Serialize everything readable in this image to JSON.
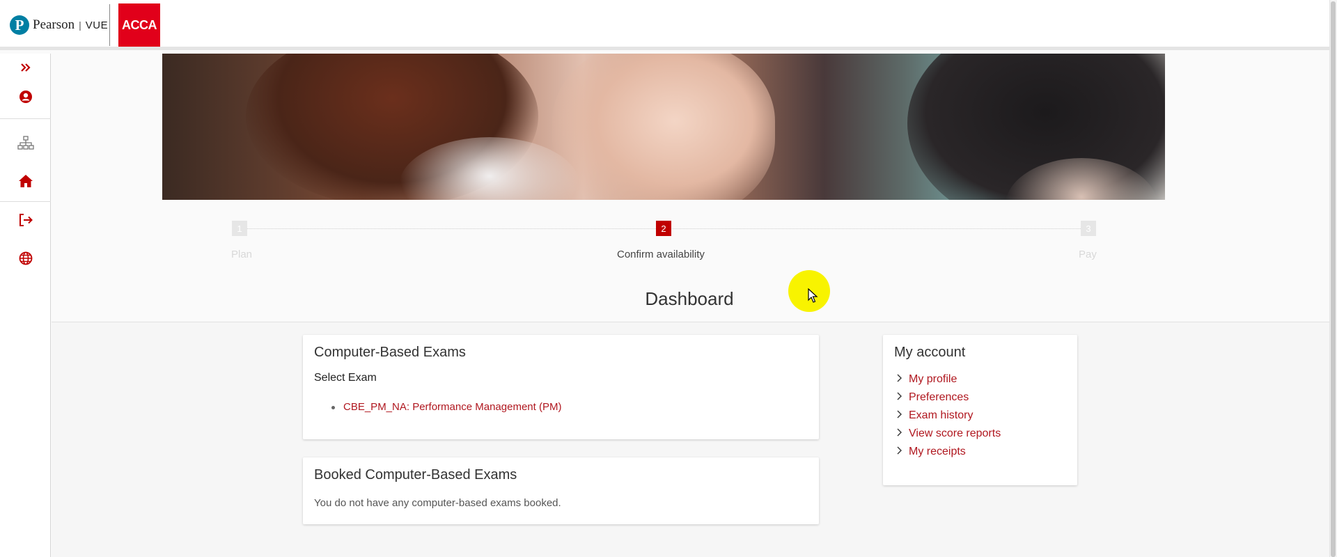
{
  "header": {
    "pearson_mark": "P",
    "pearson_word": "Pearson",
    "separator": "|",
    "vue": "VUE",
    "acca": "ACCA"
  },
  "sidebar": {
    "items": [
      {
        "icon": "expand-chevrons-icon"
      },
      {
        "icon": "user-icon"
      },
      {
        "icon": "sitemap-icon"
      },
      {
        "icon": "home-icon"
      },
      {
        "icon": "sign-out-icon"
      },
      {
        "icon": "globe-icon"
      }
    ]
  },
  "stepper": {
    "steps": [
      {
        "number": "1",
        "label": "Plan",
        "state": "inactive"
      },
      {
        "number": "2",
        "label": "Confirm availability",
        "state": "active"
      },
      {
        "number": "3",
        "label": "Pay",
        "state": "inactive"
      }
    ]
  },
  "page": {
    "title": "Dashboard"
  },
  "cbe_card": {
    "title": "Computer-Based Exams",
    "subtitle": "Select Exam",
    "exams": [
      "CBE_PM_NA: Performance Management (PM)"
    ]
  },
  "booked_card": {
    "title": "Booked Computer-Based Exams",
    "message": "You do not have any computer-based exams booked."
  },
  "account_card": {
    "title": "My account",
    "links": [
      "My profile",
      "Preferences",
      "Exam history",
      "View score reports",
      "My receipts"
    ]
  },
  "colors": {
    "brand_red": "#c00000",
    "link_red": "#b0171f",
    "pearson_blue": "#007fa3",
    "acca_red": "#e1001a"
  }
}
